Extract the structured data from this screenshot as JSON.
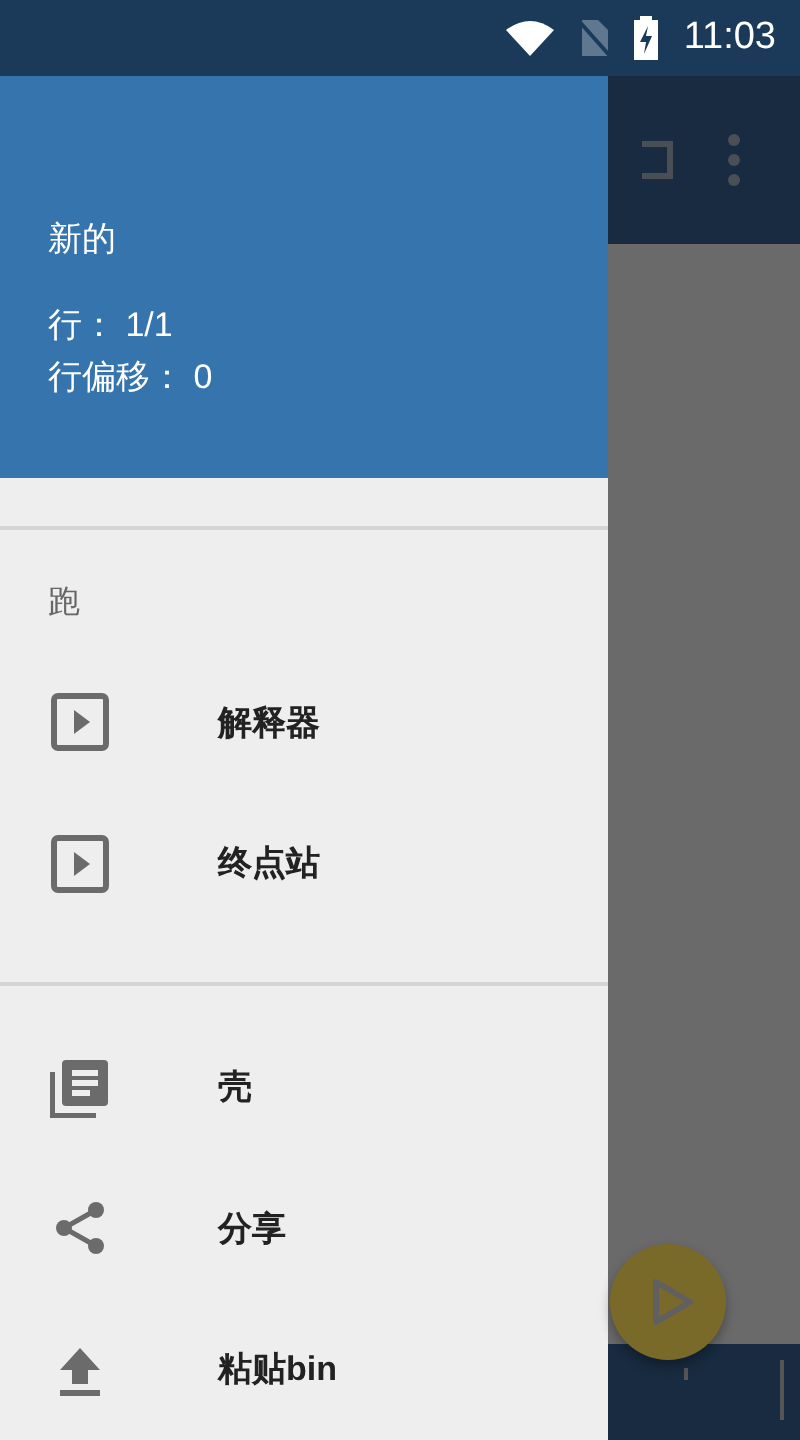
{
  "status_bar": {
    "time": "11:03"
  },
  "drawer": {
    "header": {
      "title": "新的",
      "lines": [
        "行： 1/1",
        "行偏移： 0"
      ]
    },
    "sections": [
      {
        "title": "跑",
        "items": [
          {
            "label": "解释器"
          },
          {
            "label": "终点站"
          }
        ]
      },
      {
        "items": [
          {
            "label": "壳"
          },
          {
            "label": "分享"
          },
          {
            "label": "粘贴bin"
          }
        ]
      }
    ]
  }
}
